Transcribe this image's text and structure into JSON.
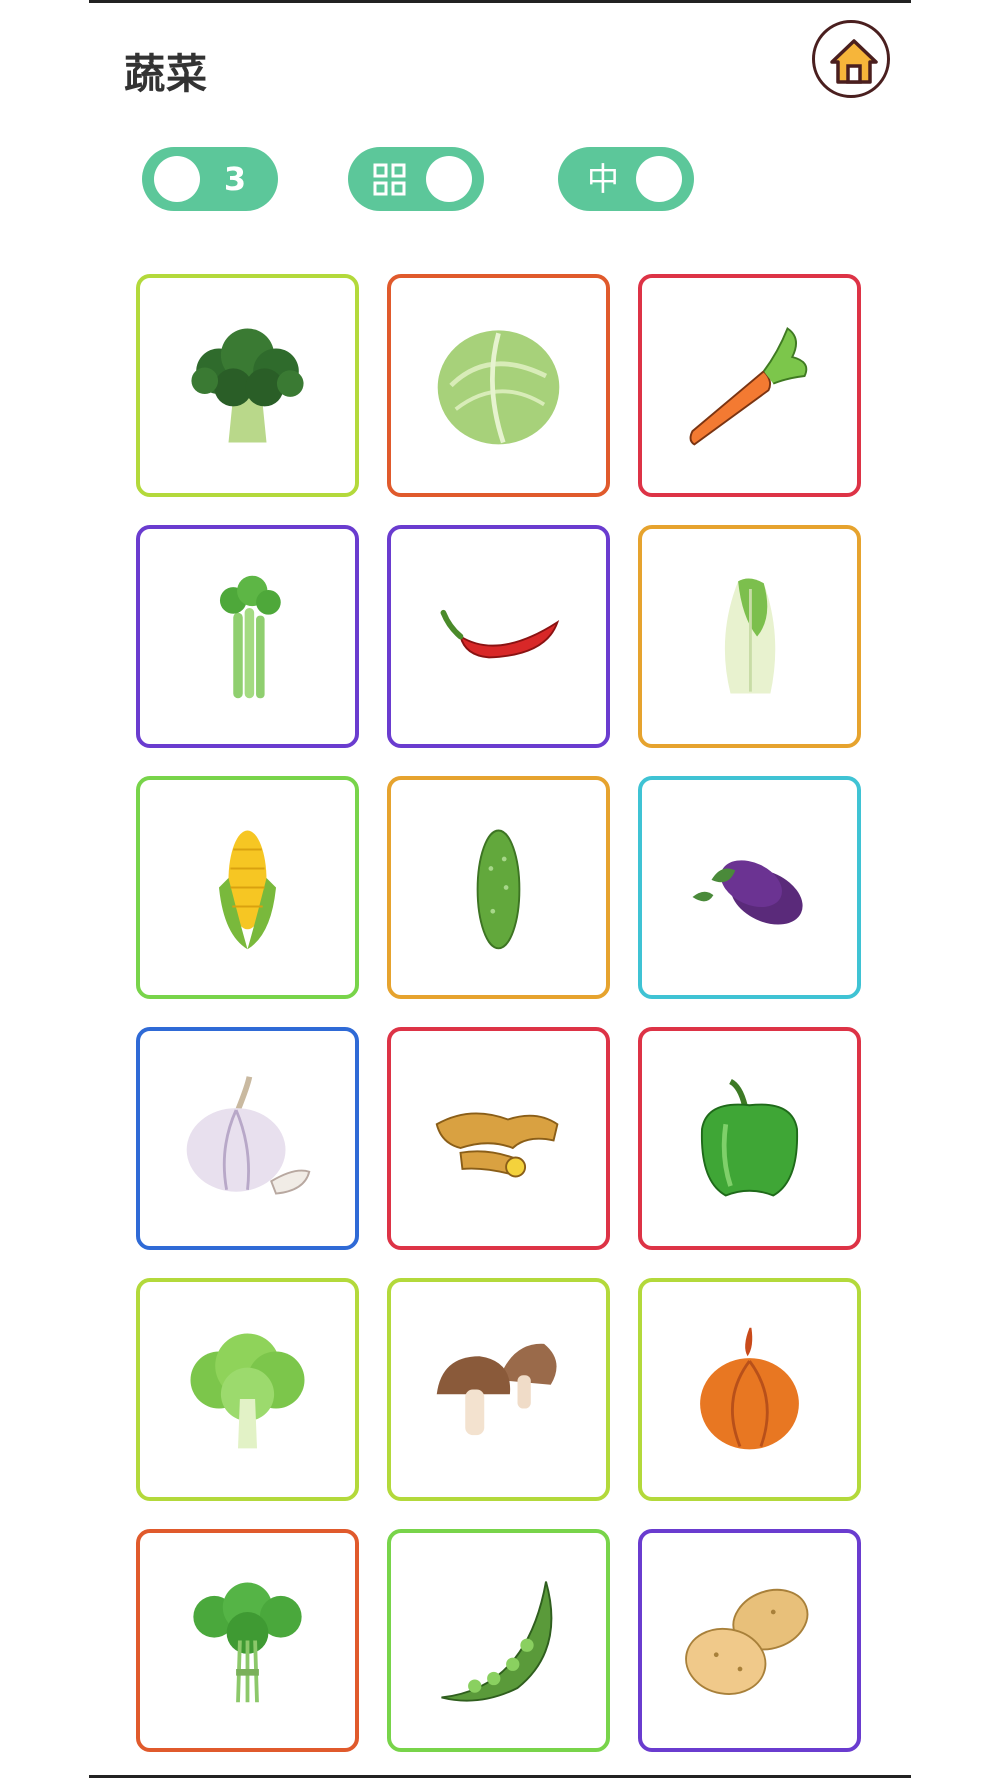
{
  "header": {
    "title": "蔬菜"
  },
  "toggles": {
    "count_value": "3",
    "size_value": "中"
  },
  "icons": {
    "home": "home-icon",
    "grid": "grid-icon"
  },
  "colors": {
    "accent": "#5cc79a",
    "home_fill": "#f6b53a",
    "home_border": "#4a1f1f"
  },
  "cards": [
    {
      "name": "broccoli",
      "icon": "broccoli-icon",
      "border": "#b3d93b"
    },
    {
      "name": "cabbage",
      "icon": "cabbage-icon",
      "border": "#e05a2c"
    },
    {
      "name": "carrot",
      "icon": "carrot-icon",
      "border": "#dd3346"
    },
    {
      "name": "celery",
      "icon": "celery-icon",
      "border": "#6a3ccf"
    },
    {
      "name": "chili-pepper",
      "icon": "chili-pepper-icon",
      "border": "#6a3ccf"
    },
    {
      "name": "napa-cabbage",
      "icon": "napa-cabbage-icon",
      "border": "#e6a32e"
    },
    {
      "name": "corn",
      "icon": "corn-icon",
      "border": "#78d44a"
    },
    {
      "name": "cucumber",
      "icon": "cucumber-icon",
      "border": "#e6a32e"
    },
    {
      "name": "eggplant",
      "icon": "eggplant-icon",
      "border": "#3fc3d4"
    },
    {
      "name": "garlic",
      "icon": "garlic-icon",
      "border": "#2f6ad6"
    },
    {
      "name": "ginger",
      "icon": "ginger-icon",
      "border": "#dd3346"
    },
    {
      "name": "green-pepper",
      "icon": "green-pepper-icon",
      "border": "#dd3346"
    },
    {
      "name": "lettuce",
      "icon": "lettuce-icon",
      "border": "#b3d93b"
    },
    {
      "name": "mushroom",
      "icon": "mushroom-icon",
      "border": "#b3d93b"
    },
    {
      "name": "onion",
      "icon": "onion-icon",
      "border": "#b3d93b"
    },
    {
      "name": "cilantro",
      "icon": "cilantro-icon",
      "border": "#e05a2c"
    },
    {
      "name": "pea-pod",
      "icon": "pea-pod-icon",
      "border": "#78d44a"
    },
    {
      "name": "potato",
      "icon": "potato-icon",
      "border": "#6a3ccf"
    }
  ]
}
